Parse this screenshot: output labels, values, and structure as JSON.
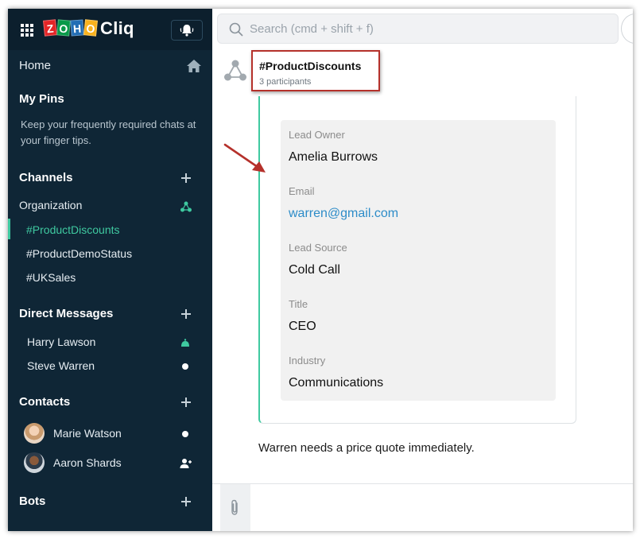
{
  "app": {
    "brand": "ZOHO",
    "brand_letters": [
      "Z",
      "O",
      "H",
      "O"
    ],
    "product": "Cliq",
    "colors": {
      "sidebar_bg": "#0f2636",
      "accent": "#3fc9a0",
      "link": "#2d8cc8",
      "highlight_box": "#b5312b"
    }
  },
  "search": {
    "placeholder": "Search (cmd + shift + f)"
  },
  "sidebar": {
    "home_label": "Home",
    "pins": {
      "title": "My Pins",
      "description": "Keep your frequently required chats at your finger tips."
    },
    "channels": {
      "title": "Channels",
      "org_label": "Organization",
      "items": [
        "#ProductDiscounts",
        "#ProductDemoStatus",
        "#UKSales"
      ],
      "active_index": 0
    },
    "direct_messages": {
      "title": "Direct Messages",
      "items": [
        {
          "name": "Harry Lawson",
          "status_icon": "bot-status-icon"
        },
        {
          "name": "Steve Warren",
          "status_icon": "online-dot"
        }
      ]
    },
    "contacts": {
      "title": "Contacts",
      "items": [
        {
          "name": "Marie Watson",
          "status_icon": "online-dot"
        },
        {
          "name": "Aaron Shards",
          "status_icon": "add-contact-icon"
        }
      ]
    },
    "bots": {
      "title": "Bots"
    }
  },
  "chat": {
    "channel_name": "#ProductDiscounts",
    "participants": "3 participants",
    "card_fields": [
      {
        "label": "Lead Owner",
        "value": "Amelia Burrows"
      },
      {
        "label": "Email",
        "value": "warren@gmail.com"
      },
      {
        "label": "Lead Source",
        "value": "Cold Call"
      },
      {
        "label": "Title",
        "value": "CEO"
      },
      {
        "label": "Industry",
        "value": "Communications"
      }
    ],
    "message": "Warren needs a price quote immediately."
  }
}
